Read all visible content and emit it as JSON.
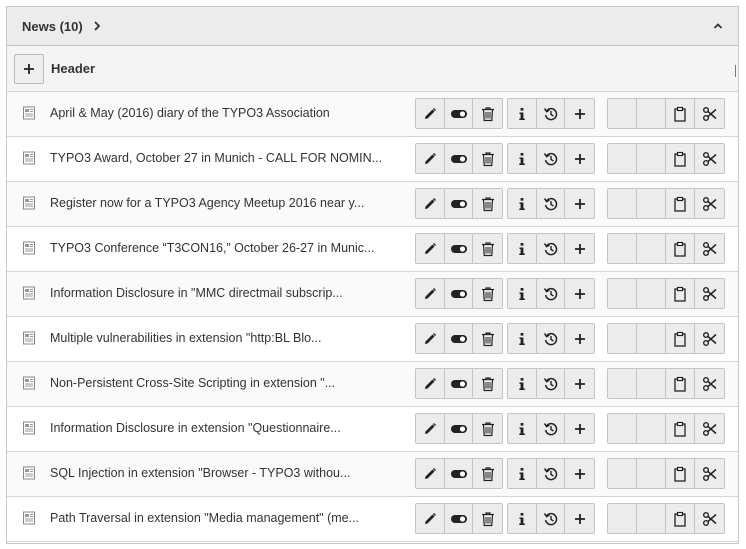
{
  "panel": {
    "title": "News (10)"
  },
  "header": {
    "label": "Header"
  },
  "rows": [
    {
      "title": "April & May (2016) diary of the TYPO3 Association"
    },
    {
      "title": "TYPO3 Award, October 27 in Munich - CALL FOR NOMIN..."
    },
    {
      "title": "Register now for a TYPO3 Agency Meetup 2016 near y..."
    },
    {
      "title": "TYPO3 Conference “T3CON16,” October 26-27 in Munic..."
    },
    {
      "title": "Information Disclosure in \"MMC directmail subscrip..."
    },
    {
      "title": "Multiple vulnerabilities in extension \"http:BL Blo..."
    },
    {
      "title": "Non-Persistent Cross-Site Scripting in extension \"..."
    },
    {
      "title": "Information Disclosure in extension \"Questionnaire..."
    },
    {
      "title": "SQL Injection in extension \"Browser - TYPO3 withou..."
    },
    {
      "title": "Path Traversal in extension \"Media management\" (me..."
    }
  ]
}
